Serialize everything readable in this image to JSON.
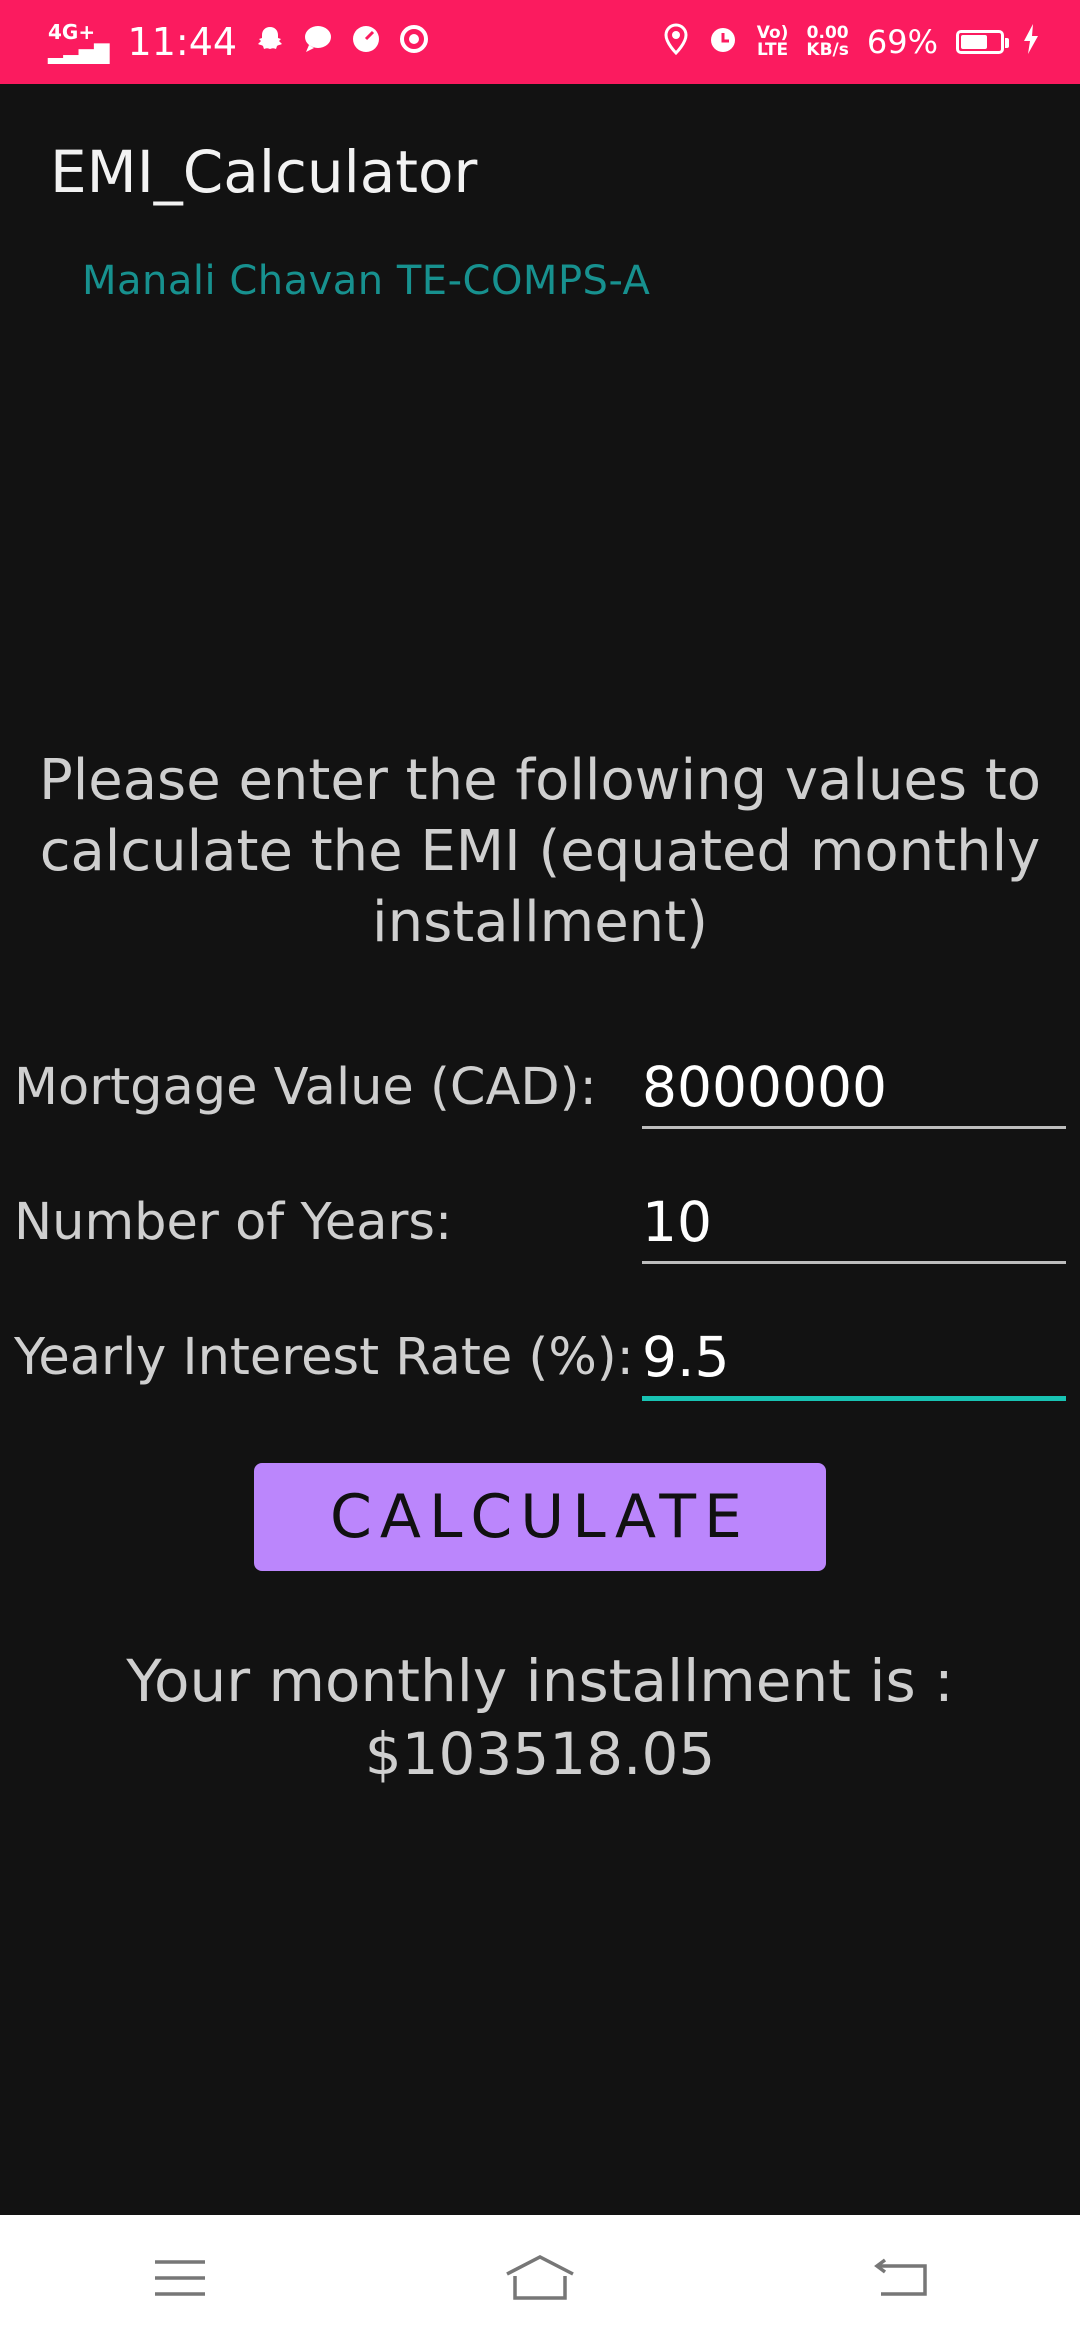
{
  "status_bar": {
    "network": "4G+",
    "time": "11:44",
    "volte": "Vo)",
    "lte": "LTE",
    "speed_value": "0.00",
    "speed_unit": "KB/s",
    "battery_percent": "69%",
    "battery_level": 0.69
  },
  "app": {
    "title": "EMI_Calculator",
    "author": "Manali Chavan TE-COMPS-A",
    "intro": "Please enter the following values to calculate the EMI (equated monthly installment)"
  },
  "form": {
    "mortgage": {
      "label": "Mortgage Value (CAD):",
      "value": "8000000"
    },
    "years": {
      "label": "Number of Years:",
      "value": "10"
    },
    "interest": {
      "label": "Yearly Interest Rate (%):",
      "value": "9.5"
    },
    "calculate_label": "CALCULATE"
  },
  "result": {
    "label": "Your monthly installment is :",
    "value": "$103518.05"
  },
  "colors": {
    "status_bar": "#fb1b5f",
    "background": "#121212",
    "accent": "#bb86fc",
    "teal": "#17918f",
    "focus_underline": "#18c3b3"
  },
  "nav": {
    "icons": [
      "menu-icon",
      "home-icon",
      "back-icon"
    ]
  }
}
